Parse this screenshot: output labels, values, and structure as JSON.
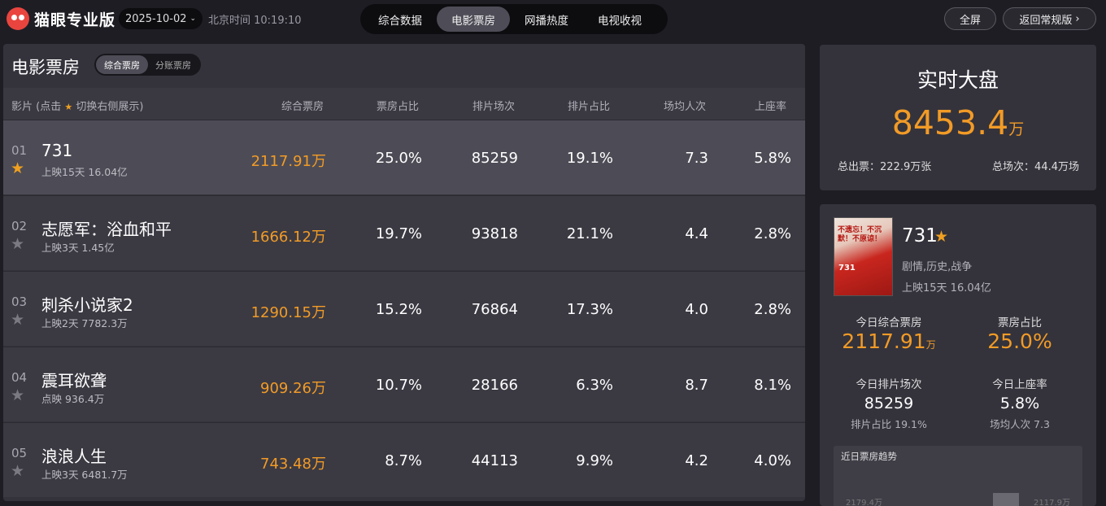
{
  "header": {
    "logo_text": "猫眼专业版",
    "date": "2025-10-02",
    "clock": "北京时间 10:19:10",
    "tabs": [
      {
        "label": "综合数据"
      },
      {
        "label": "电影票房"
      },
      {
        "label": "网播热度"
      },
      {
        "label": "电视收视"
      }
    ],
    "active_tab": "电影票房",
    "fullscreen_label": "全屏",
    "back_label": "返回常规版"
  },
  "box_office": {
    "title": "电影票房",
    "toggle": {
      "on": "综合票房",
      "off": "分账票房"
    },
    "columns": {
      "film": "影片 (点击",
      "film_hint": "切换右侧展示)",
      "box": "综合票房",
      "box_ratio": "票房占比",
      "shows": "排片场次",
      "show_ratio": "排片占比",
      "avg_people": "场均人次",
      "occupancy": "上座率"
    },
    "rows": [
      {
        "rank": "01",
        "title": "731",
        "sub": "上映15天  16.04亿",
        "box": "2117.91万",
        "box_ratio": "25.0%",
        "shows": "85259",
        "show_ratio": "19.1%",
        "avg": "7.3",
        "occ": "5.8%"
      },
      {
        "rank": "02",
        "title": "志愿军：浴血和平",
        "sub": "上映3天  1.45亿",
        "box": "1666.12万",
        "box_ratio": "19.7%",
        "shows": "93818",
        "show_ratio": "21.1%",
        "avg": "4.4",
        "occ": "2.8%"
      },
      {
        "rank": "03",
        "title": "刺杀小说家2",
        "sub": "上映2天  7782.3万",
        "box": "1290.15万",
        "box_ratio": "15.2%",
        "shows": "76864",
        "show_ratio": "17.3%",
        "avg": "4.0",
        "occ": "2.8%"
      },
      {
        "rank": "04",
        "title": "震耳欲聋",
        "sub": "点映  936.4万",
        "box": "909.26万",
        "box_ratio": "10.7%",
        "shows": "28166",
        "show_ratio": "6.3%",
        "avg": "8.7",
        "occ": "8.1%"
      },
      {
        "rank": "05",
        "title": "浪浪人生",
        "sub": "上映3天  6481.7万",
        "box": "743.48万",
        "box_ratio": "8.7%",
        "shows": "44113",
        "show_ratio": "9.9%",
        "avg": "4.2",
        "occ": "4.0%"
      }
    ]
  },
  "realtime": {
    "title": "实时大盘",
    "value": "8453.4",
    "unit": "万",
    "tickets": "总出票：222.9万张",
    "shows": "总场次：44.4万场"
  },
  "detail": {
    "poster_text": "不遗忘！不沉默！不原谅！",
    "poster_num": "731",
    "title": "731",
    "genre": "剧情,历史,战争",
    "days": "上映15天  16.04亿",
    "today_box_label": "今日综合票房",
    "today_box": "2117.91",
    "today_box_unit": "万",
    "box_ratio_label": "票房占比",
    "box_ratio": "25.0%",
    "shows_label": "今日排片场次",
    "shows": "85259",
    "show_ratio": "排片占比 19.1%",
    "occ_label": "今日上座率",
    "occ": "5.8%",
    "avg": "场均人次 7.3",
    "trend_title": "近日票房趋势",
    "trend_v1": "2179.4万",
    "trend_v2": "2117.9万"
  },
  "colors": {
    "accent": "#f29b26",
    "star": "#f0a020",
    "panel": "#34333c",
    "bg": "#1e1d24"
  }
}
